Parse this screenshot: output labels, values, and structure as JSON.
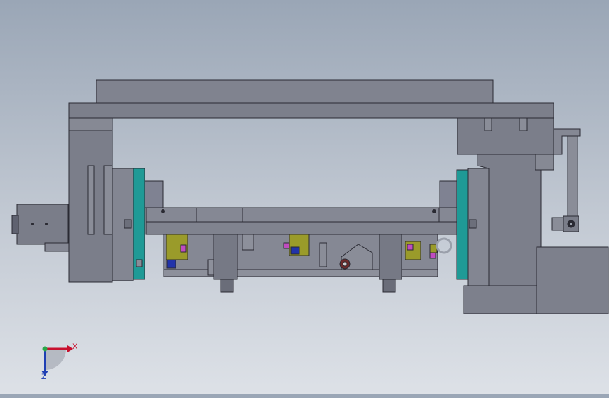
{
  "viewport": {
    "background_top": "#9aa6b6",
    "background_bottom": "#dde1e7",
    "part_color": "#7f8292",
    "part_edge": "#2a2a33",
    "accent_teal": "#1f9a96",
    "accent_olive": "#9a9b2a",
    "accent_magenta": "#c04cc0",
    "accent_blue": "#2233aa"
  },
  "triad": {
    "x_label": "X",
    "y_label": "Z",
    "x_color": "#c8102e",
    "y_color": "#1f3fb4",
    "origin_color": "#2aa84a"
  }
}
